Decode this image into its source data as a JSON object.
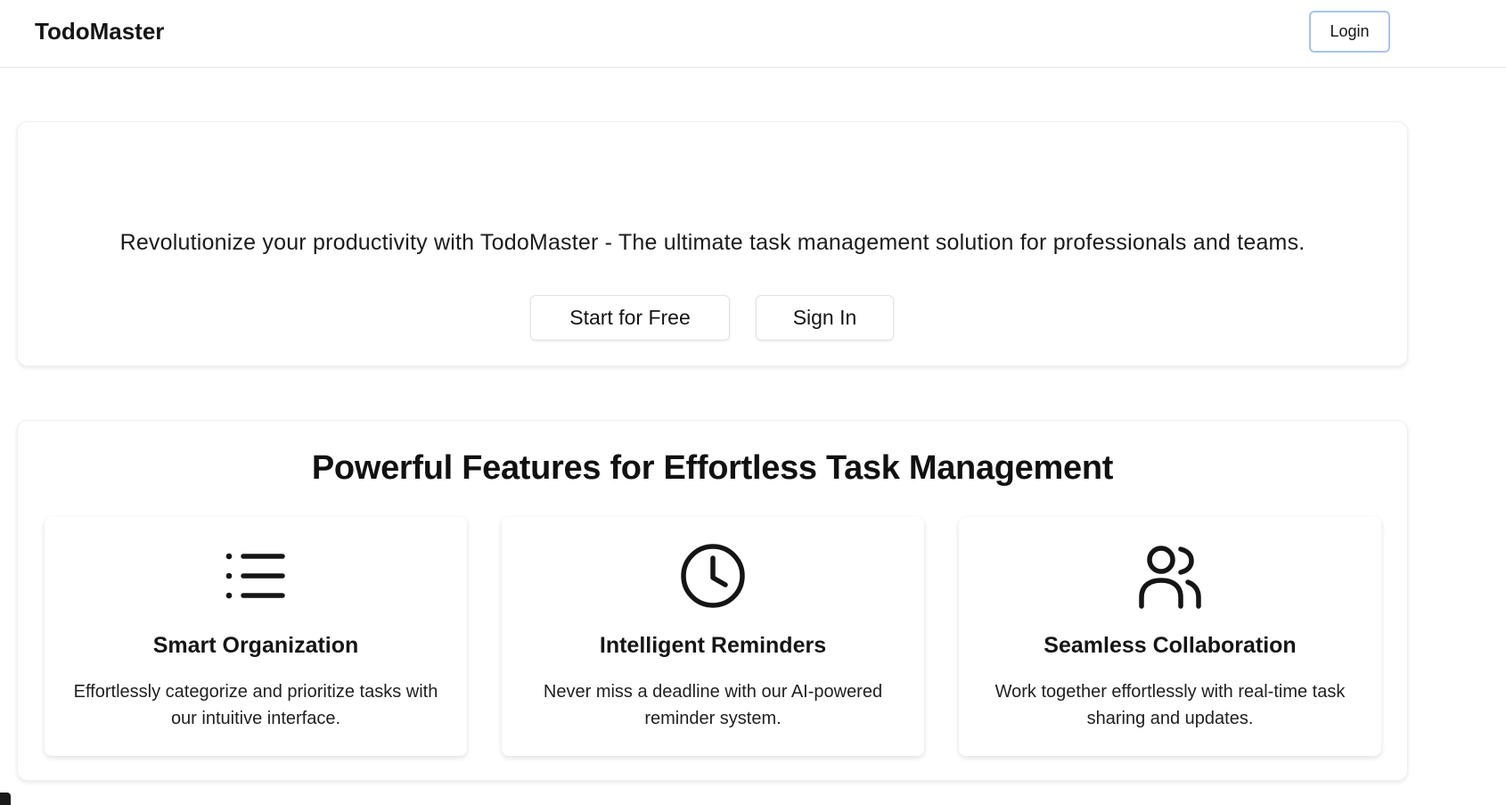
{
  "header": {
    "brand": "TodoMaster",
    "login_label": "Login"
  },
  "hero": {
    "tagline": "Revolutionize your productivity with TodoMaster - The ultimate task management solution for professionals and teams.",
    "start_label": "Start for Free",
    "signin_label": "Sign In"
  },
  "features": {
    "title": "Powerful Features for Effortless Task Management",
    "cards": [
      {
        "icon": "list-icon",
        "title": "Smart Organization",
        "description": "Effortlessly categorize and prioritize tasks with our intuitive interface."
      },
      {
        "icon": "clock-icon",
        "title": "Intelligent Reminders",
        "description": "Never miss a deadline with our AI-powered reminder system."
      },
      {
        "icon": "users-icon",
        "title": "Seamless Collaboration",
        "description": "Work together effortlessly with real-time task sharing and updates."
      }
    ]
  },
  "colors": {
    "text": "#111111",
    "login_border": "#a9c4ea",
    "card_border": "#f0f0f0",
    "divider": "#e6e6e6"
  }
}
